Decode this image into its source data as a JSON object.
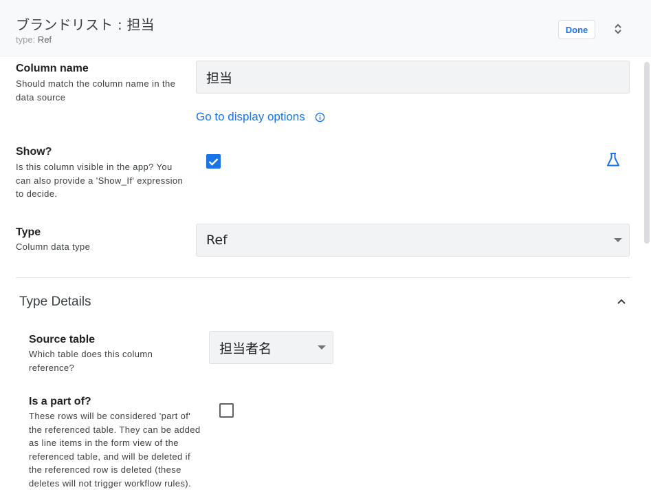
{
  "header": {
    "title": "ブランドリスト : 担当",
    "subtitle_prefix": "type:",
    "subtitle_value": "Ref",
    "done_label": "Done",
    "expand_icon": "unfold-more-icon"
  },
  "column_name": {
    "label": "Column name",
    "description": "Should match the column name in the data source",
    "value": "担当",
    "link": "Go to display options",
    "link_icon": "info-icon"
  },
  "show": {
    "label": "Show?",
    "description": "Is this column visible in the app? You can also provide a 'Show_If' expression to decide.",
    "checked": true,
    "expression_icon": "flask-icon"
  },
  "type": {
    "label": "Type",
    "description": "Column data type",
    "value": "Ref"
  },
  "type_details": {
    "title": "Type Details",
    "collapse_icon": "chevron-up-icon",
    "source_table": {
      "label": "Source table",
      "description": "Which table does this column reference?",
      "value": "担当者名"
    },
    "is_part_of": {
      "label": "Is a part of?",
      "description": "These rows will be considered 'part of' the referenced table. They can be added as line items in the form view of the referenced table, and will be deleted if the referenced row is deleted (these deletes will not trigger workflow rules).",
      "checked": false
    }
  },
  "colors": {
    "accent": "#1a73e8",
    "header_bg": "#f8f9fa",
    "field_bg": "#f1f3f4"
  }
}
